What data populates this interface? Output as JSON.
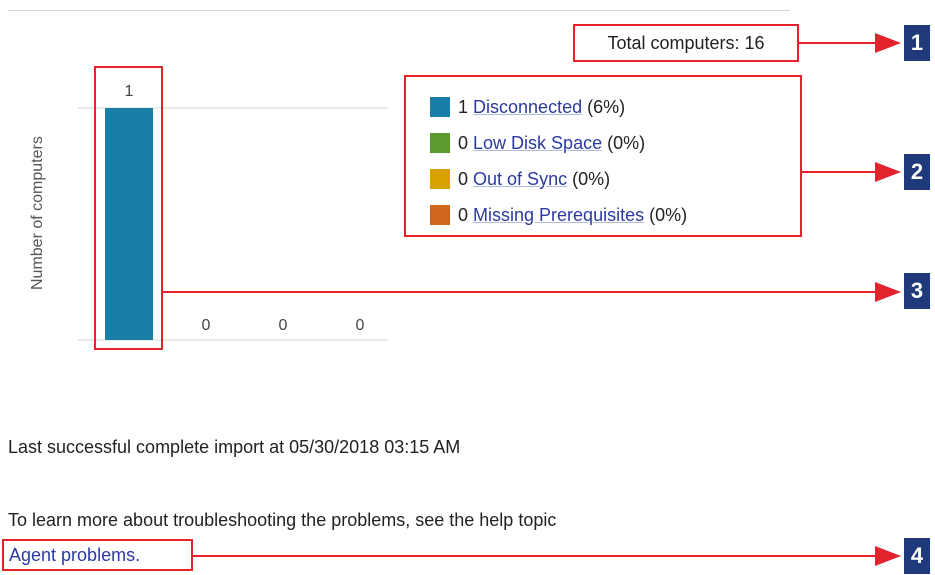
{
  "summary": {
    "total_label": "Total computers: 16"
  },
  "chart_data": {
    "type": "bar",
    "ylabel": "Number of computers",
    "categories": [
      "Disconnected",
      "Low Disk Space",
      "Out of Sync",
      "Missing Prerequisites"
    ],
    "values": [
      1,
      0,
      0,
      0
    ],
    "data_labels": [
      "1",
      "0",
      "0",
      "0"
    ],
    "colors": [
      "#1a7fa8",
      "#5b9a2e",
      "#d8a100",
      "#d0651c"
    ],
    "ylim": [
      0,
      1
    ]
  },
  "legend": {
    "items": [
      {
        "count": "1",
        "label": "Disconnected",
        "percent": "(6%)",
        "color": "#1a7fa8"
      },
      {
        "count": "0",
        "label": "Low Disk Space",
        "percent": "(0%)",
        "color": "#5b9a2e"
      },
      {
        "count": "0",
        "label": "Out of Sync",
        "percent": "(0%)",
        "color": "#d8a100"
      },
      {
        "count": "0",
        "label": "Missing Prerequisites",
        "percent": "(0%)",
        "color": "#d0651c"
      }
    ]
  },
  "status": {
    "import_text": "Last successful complete import at 05/30/2018 03:15 AM",
    "learn_text": "To learn more about troubleshooting the problems, see the help topic",
    "agent_link": "Agent problems."
  },
  "callouts": {
    "badges": [
      "1",
      "2",
      "3",
      "4"
    ]
  },
  "colors": {
    "callout_red": "#e2232b",
    "badge_blue": "#1f3a7a",
    "link_blue": "#2b3aa0"
  }
}
